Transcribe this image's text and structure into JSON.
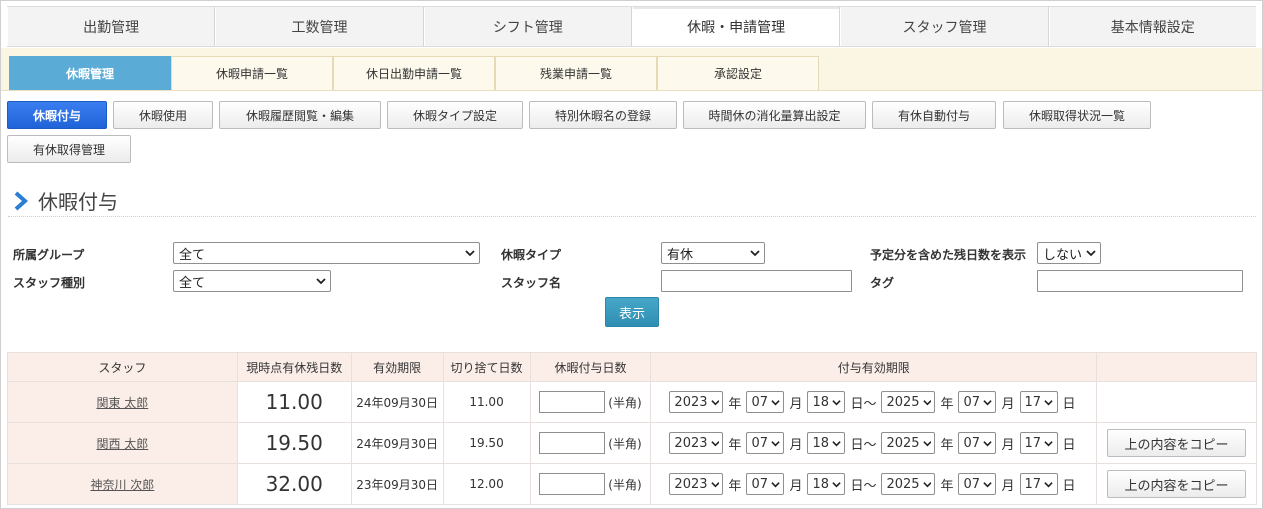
{
  "topnav": [
    "出勤管理",
    "工数管理",
    "シフト管理",
    "休暇・申請管理",
    "スタッフ管理",
    "基本情報設定"
  ],
  "subnav": [
    "休暇管理",
    "休暇申請一覧",
    "休日出勤申請一覧",
    "残業申請一覧",
    "承認設定"
  ],
  "actions": [
    "休暇付与",
    "休暇使用",
    "休暇履歴閲覧・編集",
    "休暇タイプ設定",
    "特別休暇名の登録",
    "時間休の消化量算出設定",
    "有休自動付与",
    "休暇取得状況一覧",
    "有休取得管理"
  ],
  "page_title": "休暇付与",
  "filters": {
    "group_label": "所属グループ",
    "group_value": "全て",
    "leave_type_label": "休暇タイプ",
    "leave_type_value": "有休",
    "remaining_label": "予定分を含めた残日数を表示",
    "remaining_value": "しない",
    "staff_type_label": "スタッフ種別",
    "staff_type_value": "全て",
    "staff_name_label": "スタッフ名",
    "tag_label": "タグ",
    "show_button": "表示"
  },
  "table": {
    "headers": [
      "スタッフ",
      "現時点有休残日数",
      "有効期限",
      "切り捨て日数",
      "休暇付与日数",
      "付与有効期限",
      ""
    ],
    "hankaku": "(半角)",
    "units": {
      "year": "年",
      "month": "月",
      "day": "日",
      "range": "日～"
    },
    "copy_label": "上の内容をコピー",
    "rows": [
      {
        "name": "関東 太郎",
        "remaining": "11.00",
        "expiry": "24年09月30日",
        "discard": "11.00",
        "from_y": "2023",
        "from_m": "07",
        "from_d": "18",
        "to_y": "2025",
        "to_m": "07",
        "to_d": "17",
        "copy": false
      },
      {
        "name": "関西 太郎",
        "remaining": "19.50",
        "expiry": "24年09月30日",
        "discard": "19.50",
        "from_y": "2023",
        "from_m": "07",
        "from_d": "18",
        "to_y": "2025",
        "to_m": "07",
        "to_d": "17",
        "copy": true
      },
      {
        "name": "神奈川 次郎",
        "remaining": "32.00",
        "expiry": "23年09月30日",
        "discard": "12.00",
        "from_y": "2023",
        "from_m": "07",
        "from_d": "18",
        "to_y": "2025",
        "to_m": "07",
        "to_d": "17",
        "copy": true
      }
    ]
  }
}
